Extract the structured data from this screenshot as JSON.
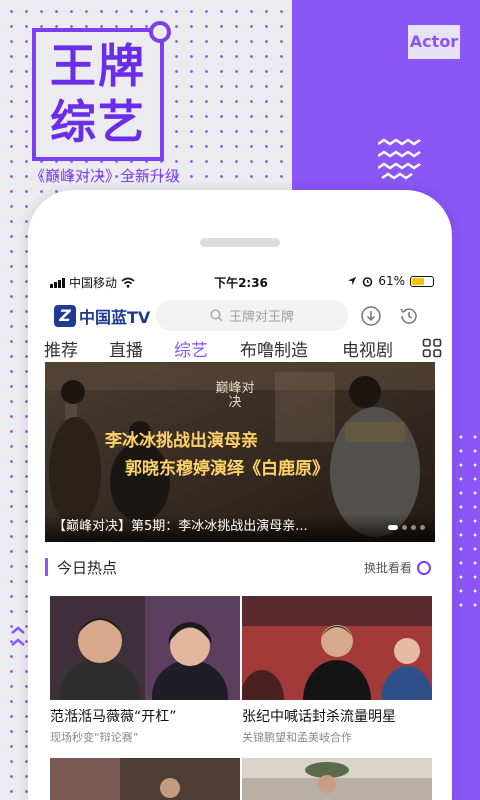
{
  "promo": {
    "logo_line1": "王牌",
    "logo_line2": "综艺",
    "slogan": "《巅峰对决》全新升级",
    "badge": "Actor",
    "accent_color": "#8b56f6"
  },
  "status_bar": {
    "carrier": "中国移动",
    "time": "下午2:36",
    "battery": "61%",
    "battery_level": 0.61
  },
  "app_bar": {
    "logo_text": "中国蓝TV",
    "logo_mark": "Z",
    "search_placeholder": "王牌对王牌",
    "icons": [
      "download-icon",
      "history-icon"
    ]
  },
  "tabs": [
    {
      "label": "推荐",
      "active": false
    },
    {
      "label": "直播",
      "active": false
    },
    {
      "label": "综艺",
      "active": true
    },
    {
      "label": "布噜制造",
      "active": false
    },
    {
      "label": "电视剧",
      "active": false
    }
  ],
  "banner": {
    "show_name": "巅峰对决",
    "headline1": "李冰冰挑战出演母亲",
    "headline2": "郭晓东穆婷演绎《白鹿原》",
    "caption": "【巅峰对决】第5期：李冰冰挑战出演母亲..."
  },
  "section": {
    "title": "今日热点",
    "more": "换批看看"
  },
  "cards": [
    {
      "title": "范湉湉马薇薇“开杠”",
      "subtitle": "现场秒变“辩论赛”"
    },
    {
      "title": "张纪中喊话封杀流量明星",
      "subtitle": "关锦鹏望和孟美岐合作"
    }
  ]
}
